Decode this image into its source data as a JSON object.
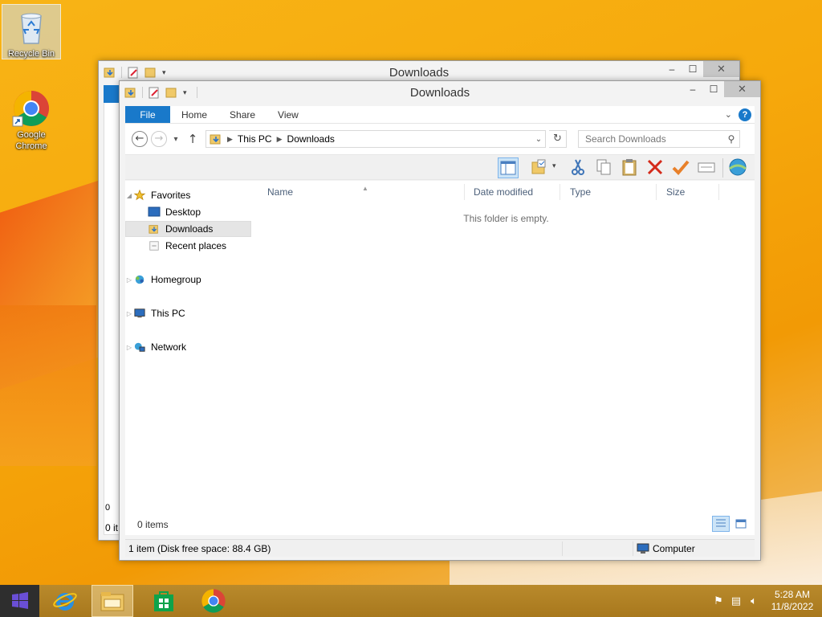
{
  "desktop": {
    "icons": [
      {
        "label": "Recycle Bin"
      },
      {
        "label": "Google Chrome"
      }
    ]
  },
  "back_window": {
    "title": "Downloads",
    "partial_texts": [
      "0",
      "0 it"
    ]
  },
  "window": {
    "title": "Downloads",
    "controls": {
      "minimize": "‒",
      "maximize": "☐",
      "close": "✕"
    },
    "ribbon_tabs": [
      "File",
      "Home",
      "Share",
      "View"
    ],
    "address": {
      "crumbs": [
        "This PC",
        "Downloads"
      ]
    },
    "search": {
      "placeholder": "Search Downloads"
    },
    "nav_pane": {
      "favorites": "Favorites",
      "desktop": "Desktop",
      "downloads": "Downloads",
      "recent": "Recent places",
      "homegroup": "Homegroup",
      "this_pc": "This PC",
      "network": "Network"
    },
    "columns": [
      "Name",
      "Date modified",
      "Type",
      "Size"
    ],
    "empty_message": "This folder is empty.",
    "items_count": "0 items",
    "status_left": "1 item (Disk free space: 88.4 GB)",
    "status_right": "Computer"
  },
  "taskbar": {
    "apps": [
      "start",
      "internet-explorer",
      "file-explorer",
      "store",
      "chrome"
    ],
    "clock": {
      "time": "5:28 AM",
      "date": "11/8/2022"
    }
  },
  "colors": {
    "accent": "#1979ca",
    "desktop_bg": "#f6a90c",
    "taskbar_bg": "#a8781d"
  }
}
